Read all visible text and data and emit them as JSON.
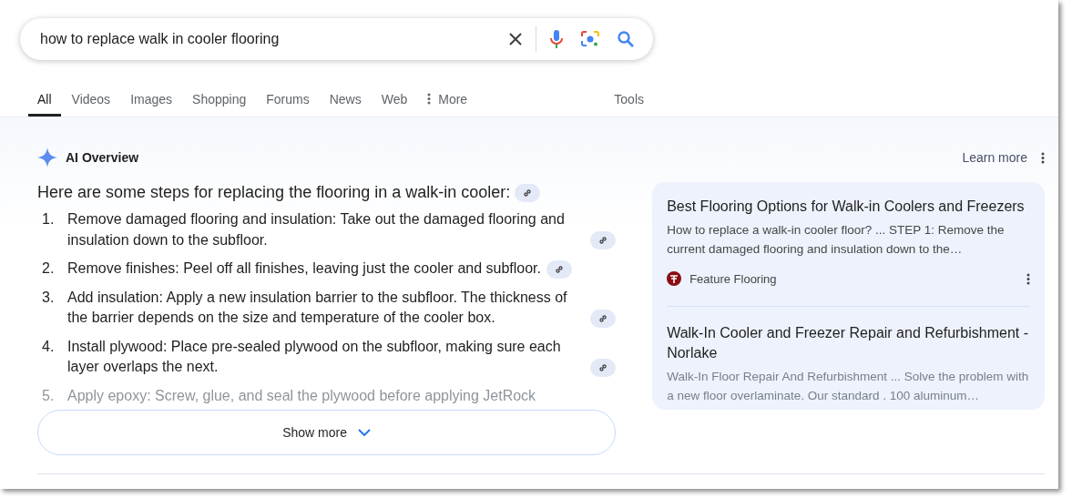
{
  "search": {
    "value": "how to replace walk in cooler flooring"
  },
  "tabs": [
    {
      "label": "All",
      "selected": true
    },
    {
      "label": "Videos",
      "selected": false
    },
    {
      "label": "Images",
      "selected": false
    },
    {
      "label": "Shopping",
      "selected": false
    },
    {
      "label": "Forums",
      "selected": false
    },
    {
      "label": "News",
      "selected": false
    },
    {
      "label": "Web",
      "selected": false
    },
    {
      "label": "More",
      "selected": false,
      "kind": "more"
    }
  ],
  "tools": "Tools",
  "ai_overview": {
    "title": "AI Overview",
    "learn_more": "Learn more",
    "intro": "Here are some steps for replacing the flooring in a walk-in cooler:",
    "steps": [
      {
        "number": "1.",
        "text": "Remove damaged flooring and insulation: Take out the damaged flooring and insulation down to the subfloor.",
        "faded": false
      },
      {
        "number": "2.",
        "text": "Remove finishes: Peel off all finishes, leaving just the cooler and subfloor.",
        "faded": false
      },
      {
        "number": "3.",
        "text": "Add insulation: Apply a new insulation barrier to the subfloor. The thickness of the barrier depends on the size and temperature of the cooler box.",
        "faded": false
      },
      {
        "number": "4.",
        "text": "Install plywood: Place pre-sealed plywood on the subfloor, making sure each layer overlaps the next.",
        "faded": false
      },
      {
        "number": "5.",
        "text": "Apply epoxy: Screw, glue, and seal the plywood before applying JetRock",
        "faded": true
      }
    ],
    "show_more": "Show more",
    "sources": [
      {
        "title": "Best Flooring Options for Walk-in Coolers and Freezers",
        "snippet": "How to replace a walk-in cooler floor? ... STEP 1: Remove the current damaged flooring and insulation down to the…",
        "site": "Feature Flooring",
        "faded": false
      },
      {
        "title": "Walk-In Cooler and Freezer Repair and Refurbishment - Norlake",
        "snippet": "Walk-In Floor Repair And Refurbishment ... Solve the problem with a new floor overlaminate. Our standard . 100 aluminum…",
        "faded": true
      }
    ]
  }
}
